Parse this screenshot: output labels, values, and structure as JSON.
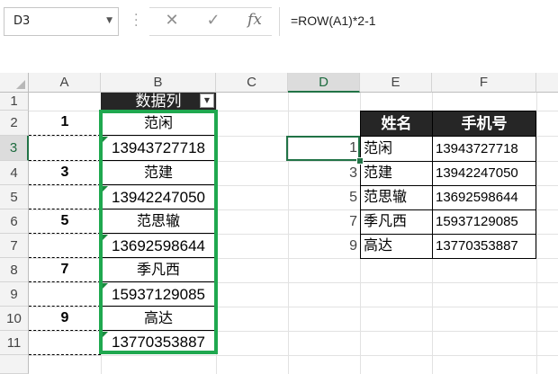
{
  "formula_bar": {
    "name_box": "D3",
    "name_box_arrow": "▼",
    "cancel_icon": "✕",
    "enter_icon": "✓",
    "fx_label": "fx",
    "formula": "=ROW(A1)*2-1"
  },
  "columns": [
    "A",
    "B",
    "C",
    "D",
    "E",
    "F"
  ],
  "rows": [
    "1",
    "2",
    "3",
    "4",
    "5",
    "6",
    "7",
    "8",
    "9",
    "10",
    "11"
  ],
  "col_a": {
    "r2": "1",
    "r4": "3",
    "r6": "5",
    "r8": "7",
    "r10": "9"
  },
  "col_b": {
    "header": "数据列",
    "filter_icon": "▼",
    "entries": [
      {
        "name": "范闲",
        "phone": "13943727718"
      },
      {
        "name": "范建",
        "phone": "13942247050"
      },
      {
        "name": "范思辙",
        "phone": "13692598644"
      },
      {
        "name": "季凡西",
        "phone": "15937129085"
      },
      {
        "name": "高达",
        "phone": "13770353887"
      }
    ]
  },
  "result_table": {
    "headers": [
      "姓名",
      "手机号"
    ],
    "rows": [
      {
        "index": "1",
        "name": "范闲",
        "phone": "13943727718"
      },
      {
        "index": "3",
        "name": "范建",
        "phone": "13942247050"
      },
      {
        "index": "5",
        "name": "范思辙",
        "phone": "13692598644"
      },
      {
        "index": "7",
        "name": "季凡西",
        "phone": "15937129085"
      },
      {
        "index": "9",
        "name": "高达",
        "phone": "13770353887"
      }
    ]
  },
  "colors": {
    "frame_green": "#1fa84f",
    "selection_green": "#217346",
    "header_dark": "#262626"
  }
}
